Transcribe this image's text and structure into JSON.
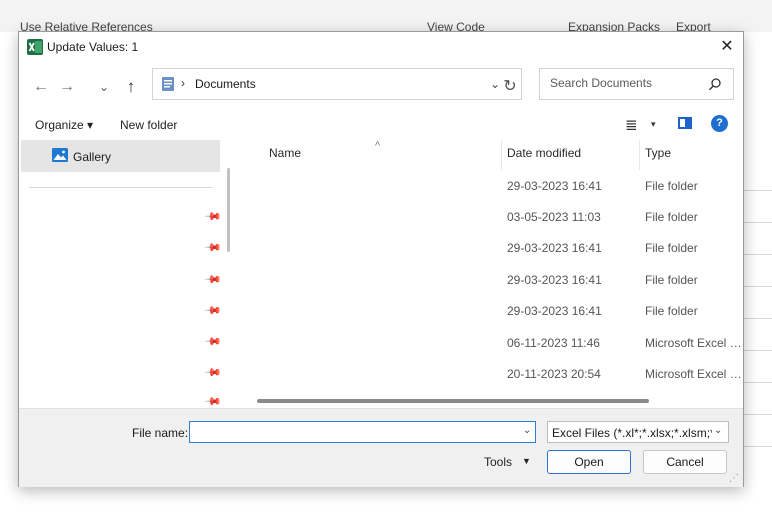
{
  "background": {
    "ribbon_items": [
      "Use Relative References",
      "View Code",
      "Expansion Packs",
      "Export"
    ]
  },
  "dialog": {
    "title": "Update Values: 1",
    "close_symbol": "✕"
  },
  "navigation": {
    "back_symbol": "←",
    "forward_symbol": "→",
    "recent_symbol": "⌄",
    "up_symbol": "↑",
    "breadcrumb_separator": "›",
    "current_folder": "Documents",
    "address_dropdown_symbol": "⌄",
    "refresh_symbol": "↻"
  },
  "search": {
    "placeholder": "Search Documents",
    "icon": "search-icon"
  },
  "toolbar": {
    "organize_label": "Organize ▾",
    "new_folder_label": "New folder",
    "view_icon": "≣",
    "view_dropdown": "▾",
    "help_label": "?"
  },
  "nav_pane": {
    "gallery_label": "Gallery",
    "pin_symbol": "📌"
  },
  "file_list": {
    "columns": {
      "name": "Name",
      "date_modified": "Date modified",
      "type": "Type"
    },
    "sort_symbol": "^",
    "rows": [
      {
        "date": "29-03-2023 16:41",
        "type": "File folder"
      },
      {
        "date": "03-05-2023 11:03",
        "type": "File folder"
      },
      {
        "date": "29-03-2023 16:41",
        "type": "File folder"
      },
      {
        "date": "29-03-2023 16:41",
        "type": "File folder"
      },
      {
        "date": "29-03-2023 16:41",
        "type": "File folder"
      },
      {
        "date": "06-11-2023 11:46",
        "type": "Microsoft Excel W..."
      },
      {
        "date": "20-11-2023 20:54",
        "type": "Microsoft Excel W..."
      }
    ]
  },
  "bottom": {
    "file_name_label": "File name:",
    "file_name_value": "",
    "file_type_value": "Excel Files (*.xl*;*.xlsx;*.xlsm;*.xls",
    "tools_label": "Tools",
    "tools_arrow": "▼",
    "open_label": "Open",
    "cancel_label": "Cancel"
  },
  "colors": {
    "accent": "#2b73d2",
    "help_icon": "#1f6fd1",
    "selected_nav": "#e5e5e5",
    "bottom_bg": "#f0f0f0"
  }
}
